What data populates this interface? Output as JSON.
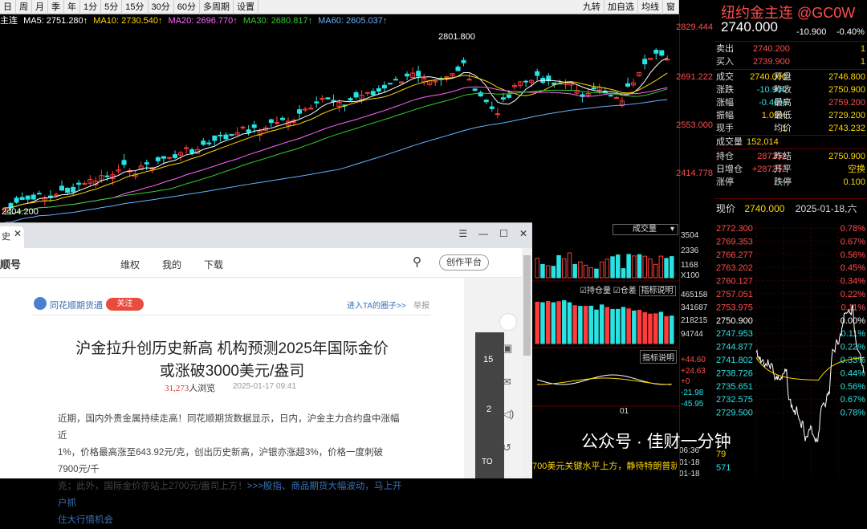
{
  "toolbar": {
    "left": [
      "日",
      "周",
      "月",
      "季",
      "年",
      "1分",
      "5分",
      "15分",
      "30分",
      "60分",
      "多周期",
      "设置"
    ],
    "right": [
      "九转",
      "加自选",
      "均线",
      "窗"
    ]
  },
  "ma": {
    "prefix": "主连",
    "ma5": "MA5: 2751.280↑",
    "ma10": "MA10: 2730.540↑",
    "ma20": "MA20: 2696.770↑",
    "ma30": "MA30: 2680.817↑",
    "ma60": "MA60: 2605.037↑"
  },
  "colors": {
    "up": "#ff3b3b",
    "down": "#29e3e3",
    "ma5": "#ffffff",
    "ma10": "#ffd700",
    "ma20": "#ff66ff",
    "ma30": "#33cc33",
    "ma60": "#66b3ff"
  },
  "chart_annotations": {
    "high": "2801.800",
    "low": "2404.200"
  },
  "price_scale": [
    "2829.444",
    "2691.222",
    "2553.000",
    "2414.778"
  ],
  "quote": {
    "title": "纽约金主连 @GC0W",
    "price": "2740.000",
    "change": "-10.900",
    "change_pct": "-0.40%",
    "sell_label": "卖出",
    "sell": "2740.200",
    "sell_vol": "1",
    "buy_label": "买入",
    "buy": "2739.900",
    "buy_vol": "1",
    "rows": [
      {
        "l": "成交",
        "v": "2740.000",
        "l2": "开盘",
        "v2": "2746.800"
      },
      {
        "l": "涨跌",
        "v": "-10.900",
        "l2": "昨收",
        "v2": "2750.900"
      },
      {
        "l": "涨幅",
        "v": "-0.40%",
        "l2": "最高",
        "v2": "2759.200"
      },
      {
        "l": "振幅",
        "v": "1.09%",
        "l2": "最低",
        "v2": "2729.200"
      },
      {
        "l": "现手",
        "v": "1",
        "l2": "均价",
        "v2": "2743.232"
      }
    ],
    "vol_label": "成交量",
    "vol": "152,014",
    "rows2": [
      {
        "l": "持仓",
        "v": "287252",
        "l2": "昨结",
        "v2": "2750.900"
      },
      {
        "l": "日增仓",
        "v": "+287252",
        "l2": "开平",
        "v2": "空换"
      },
      {
        "l": "涨停",
        "v": "--",
        "l2": "跌停",
        "v2": "0.100"
      }
    ]
  },
  "intraday": {
    "label": "现价",
    "price": "2740.000",
    "date": "2025-01-18,六",
    "prices": [
      "2772.300",
      "2769.353",
      "2766.277",
      "2763.202",
      "2760.127",
      "2757.051",
      "2753.975",
      "2750.900",
      "2747.953",
      "2744.877",
      "2741.802",
      "2738.726",
      "2735.651",
      "2732.575",
      "2729.500"
    ],
    "pcts": [
      "0.78%",
      "0.67%",
      "0.56%",
      "0.45%",
      "0.34%",
      "0.22%",
      "0.11%",
      "0.00%",
      "0.11%",
      "0.22%",
      "0.33%",
      "0.44%",
      "0.56%",
      "0.67%",
      "0.78%"
    ]
  },
  "volpanel": {
    "dropdown": "成交量",
    "chk1": "持仓量",
    "chk2": "仓差",
    "btn": "指标说明",
    "btn2": "指标说明",
    "date_label": "01",
    "news": "700美元关键水平上方，静待特朗普就...",
    "news_times": [
      "06:36",
      "01-18",
      "01-18"
    ]
  },
  "volscale": [
    "3504",
    "2336",
    "1168",
    "X100",
    "465158",
    "341687",
    "218215",
    "94744",
    "+44.60",
    "+24.63",
    "+0",
    "-21.98",
    "-45.95"
  ],
  "volscale_bottom": [
    "79",
    "571"
  ],
  "browser": {
    "tab": "史",
    "nav_logo": "顺号",
    "nav": [
      "维权",
      "我的",
      "下载"
    ],
    "creator": "创作平台",
    "source": "同花顺期货通",
    "follow": "关注",
    "enter": "进入TA的圈子>>",
    "report": "举报",
    "headline1": "沪金拉升创历史新高 机构预测2025年国际金价",
    "headline2": "或涨破3000美元/盎司",
    "views": "31,273",
    "views_label": "人浏览",
    "date": "2025-01-17 09:41",
    "para": [
      "近期，国内外贵金属持续走高！同花顺期货数据显示，日内，沪金主力合约盘中涨幅近",
      "1%，价格最高涨至643.92元/克，创出历史新高，沪银亦涨超3%，价格一度刺破7900元/千",
      "克；此外，国际金价亦站上2700元/盎司上方！"
    ],
    "link1": ">>>股指、商品期货大幅波动，马上开户抓",
    "link2": "住大行情机会",
    "side": [
      "15",
      "2",
      "TO"
    ]
  },
  "watermark": "公众号 · 佳财一分钟"
}
